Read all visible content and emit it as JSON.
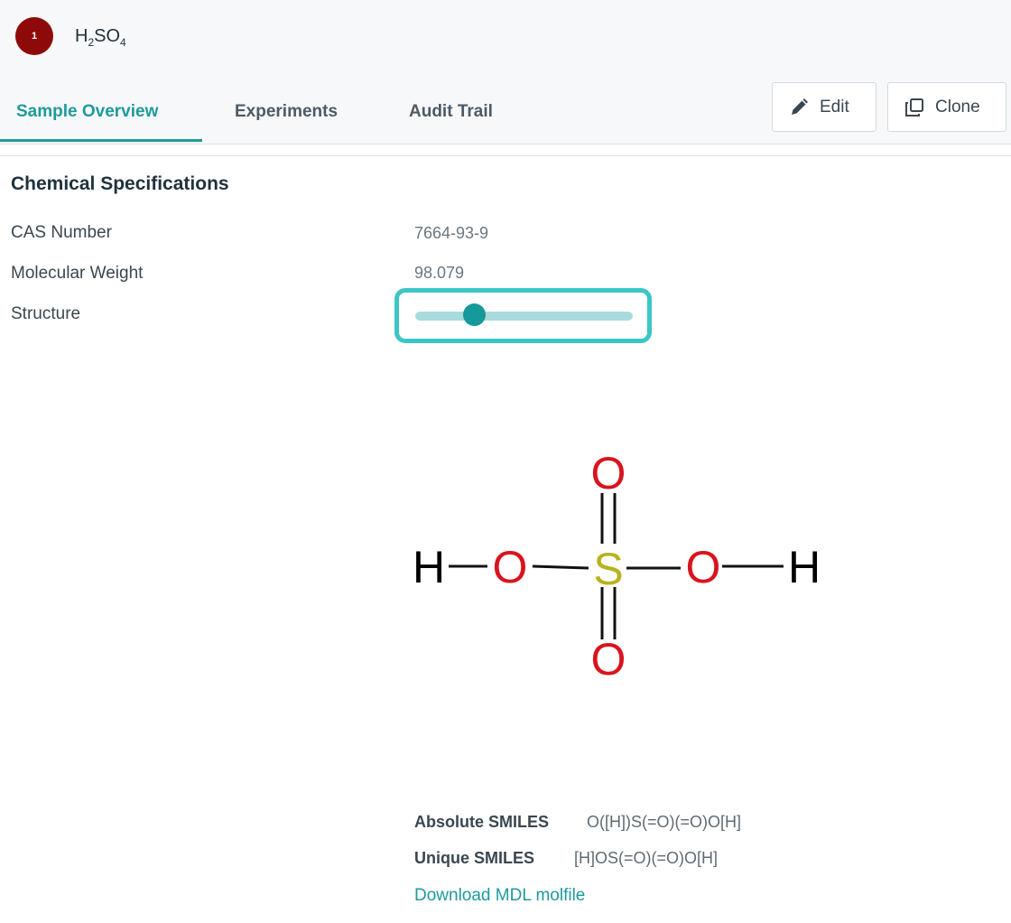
{
  "sample": {
    "badge_number": "1",
    "name_parts": [
      "H",
      "2",
      "SO",
      "4"
    ]
  },
  "tabs": [
    {
      "label": "Sample Overview",
      "active": true
    },
    {
      "label": "Experiments",
      "active": false
    },
    {
      "label": "Audit Trail",
      "active": false
    }
  ],
  "actions": {
    "edit_label": "Edit",
    "edit_icon": "pencil-icon",
    "clone_label": "Clone",
    "clone_icon": "copy-icon"
  },
  "specs": {
    "title": "Chemical Specifications",
    "cas_label": "CAS Number",
    "cas_value": "7664-93-9",
    "mw_label": "Molecular Weight",
    "mw_value": "98.079",
    "structure_label": "Structure",
    "structure_zoom_fraction": 0.27
  },
  "structure": {
    "atoms": {
      "h_left": "H",
      "o_left": "O",
      "s_center": "S",
      "o_right": "O",
      "h_right": "H",
      "o_top": "O",
      "o_bottom": "O"
    },
    "colors": {
      "hydrogen": "#000000",
      "oxygen": "#d8141d",
      "sulfur": "#b7b321"
    }
  },
  "smiles": {
    "absolute_label": "Absolute SMILES",
    "absolute_value": "O([H])S(=O)(=O)O[H]",
    "unique_label": "Unique SMILES",
    "unique_value": "[H]OS(=O)(=O)O[H]",
    "download_label": "Download MDL molfile"
  },
  "theme": {
    "accent": "#1f9a9c",
    "badge_color": "#8e0a0a",
    "focus_ring": "#3cc6c6"
  }
}
